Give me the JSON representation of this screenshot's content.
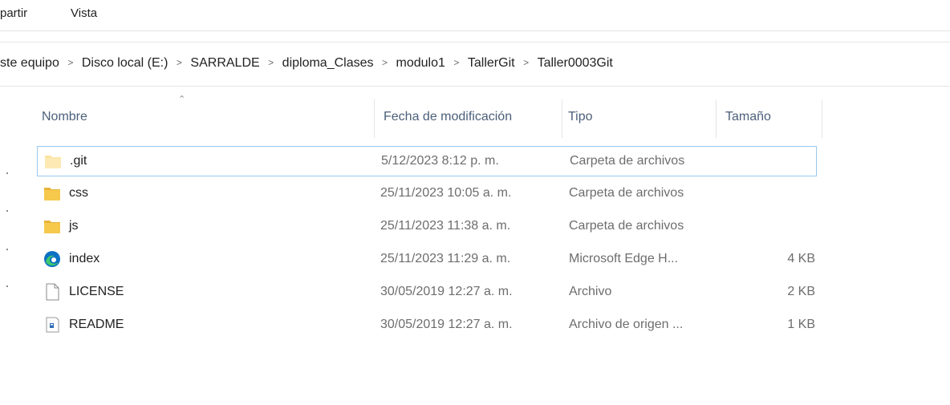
{
  "ribbon": {
    "tabs": [
      "partir",
      "Vista"
    ]
  },
  "breadcrumb": [
    "ste equipo",
    "Disco local (E:)",
    "SARRALDE",
    "diploma_Clases",
    "modulo1",
    "TallerGit",
    "Taller0003Git"
  ],
  "columns": {
    "name": "Nombre",
    "modified": "Fecha de modificación",
    "type": "Tipo",
    "size": "Tamaño"
  },
  "files": [
    {
      "name": ".git",
      "modified": "5/12/2023 8:12 p. m.",
      "type": "Carpeta de archivos",
      "size": "",
      "icon": "folder-icon-light"
    },
    {
      "name": "css",
      "modified": "25/11/2023 10:05 a. m.",
      "type": "Carpeta de archivos",
      "size": "",
      "icon": "folder-icon"
    },
    {
      "name": "js",
      "modified": "25/11/2023 11:38 a. m.",
      "type": "Carpeta de archivos",
      "size": "",
      "icon": "folder-icon"
    },
    {
      "name": "index",
      "modified": "25/11/2023 11:29 a. m.",
      "type": "Microsoft Edge H...",
      "size": "4 KB",
      "icon": "edge-icon"
    },
    {
      "name": "LICENSE",
      "modified": "30/05/2019 12:27 a. m.",
      "type": "Archivo",
      "size": "2 KB",
      "icon": "blank-file-icon"
    },
    {
      "name": "README",
      "modified": "30/05/2019 12:27 a. m.",
      "type": "Archivo de origen ...",
      "size": "1 KB",
      "icon": "source-file-icon"
    }
  ],
  "colors": {
    "folder": "#f6c94d",
    "folder_light": "#fbe3a2",
    "selection_border": "#99c9ef",
    "header_text": "#4c607a",
    "edge_blue": "#0c71c3",
    "edge_green": "#3dc96e"
  }
}
